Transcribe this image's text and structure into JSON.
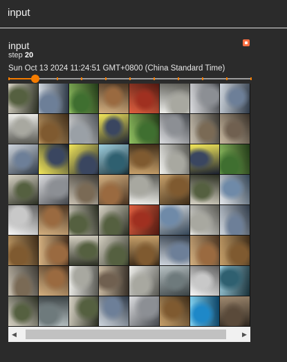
{
  "header": {
    "title": "input"
  },
  "card": {
    "title": "input",
    "step_label": "step",
    "step_value": "20",
    "timestamp": "Sun Oct 13 2024 11:24:51 GMT+0800 (China Standard Time)",
    "slider": {
      "value_fraction": 0.11,
      "tick_count": 10
    },
    "colors": {
      "accent": "#f57c00",
      "pin": "#ff7043"
    }
  },
  "image_grid": {
    "rows": 8,
    "cols": 8
  },
  "icons": {
    "pin": "pin-icon",
    "scroll_left": "arrow-left-icon",
    "scroll_right": "arrow-right-icon"
  }
}
